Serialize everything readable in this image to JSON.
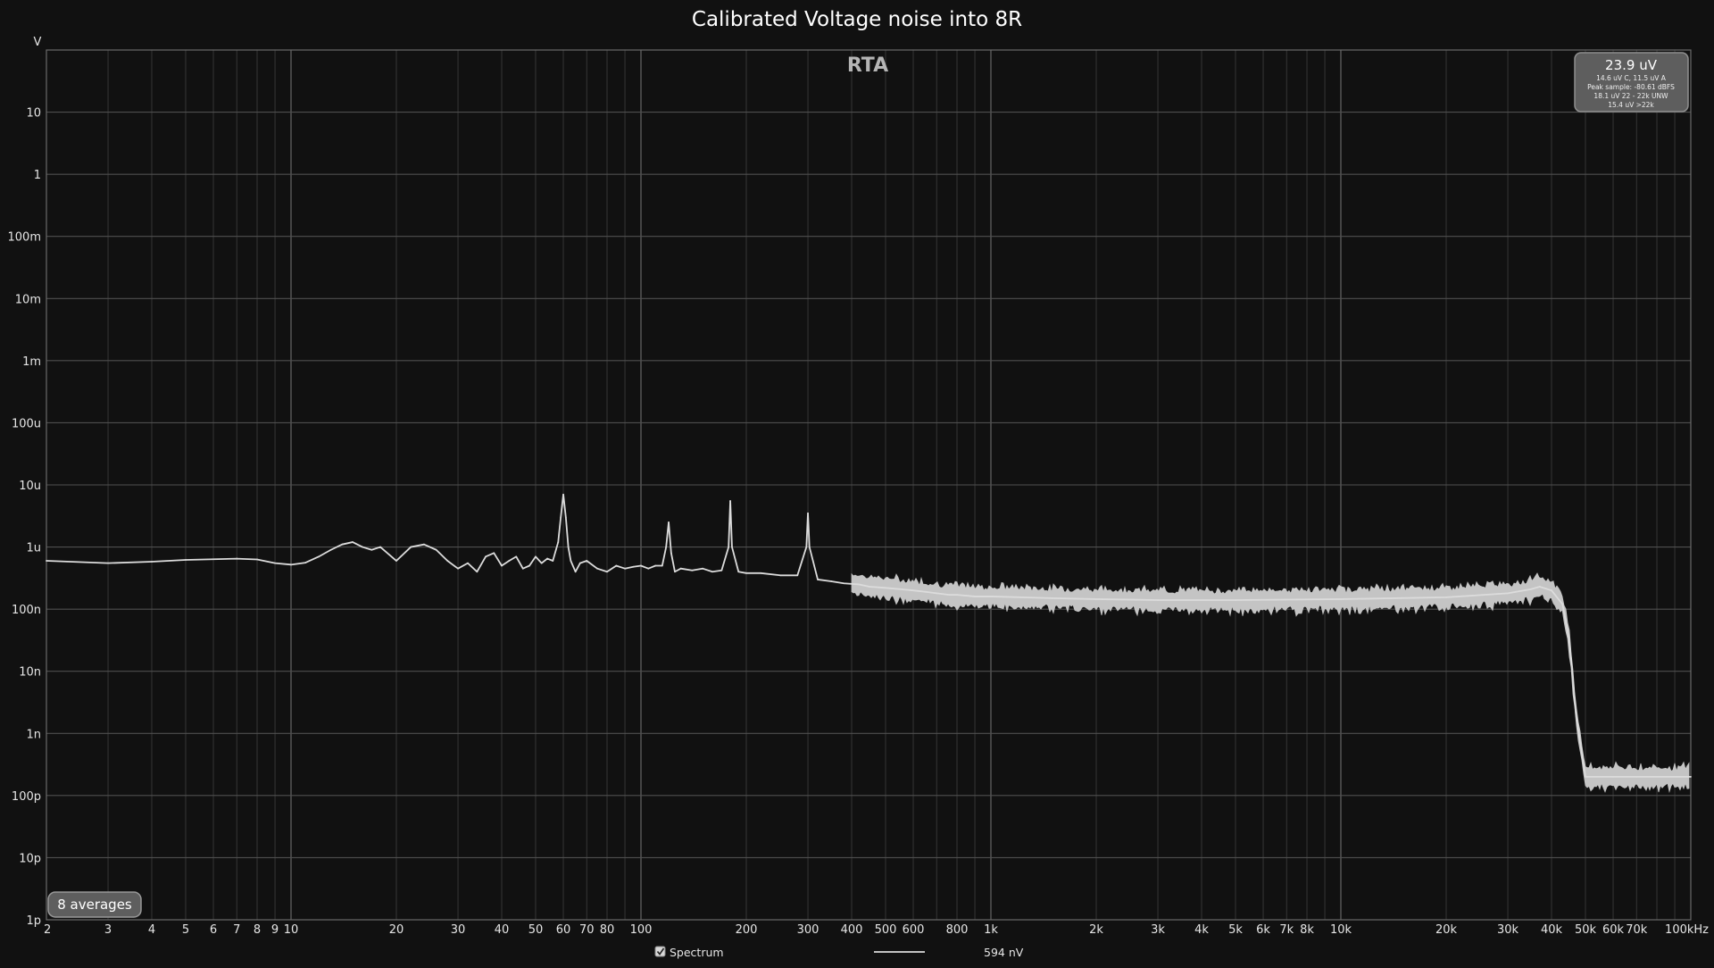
{
  "chart_data": {
    "type": "line",
    "title": "Calibrated Voltage noise into 8R",
    "watermark": "RTA",
    "y_unit_label": "V",
    "x_scale": "log",
    "y_scale": "log",
    "xlim": [
      2,
      100000
    ],
    "ylim": [
      1e-12,
      100
    ],
    "x_ticks": [
      {
        "v": 2,
        "label": "2"
      },
      {
        "v": 3,
        "label": "3"
      },
      {
        "v": 4,
        "label": "4"
      },
      {
        "v": 5,
        "label": "5"
      },
      {
        "v": 6,
        "label": "6"
      },
      {
        "v": 7,
        "label": "7"
      },
      {
        "v": 8,
        "label": "8"
      },
      {
        "v": 9,
        "label": "9"
      },
      {
        "v": 10,
        "label": "10"
      },
      {
        "v": 20,
        "label": "20"
      },
      {
        "v": 30,
        "label": "30"
      },
      {
        "v": 40,
        "label": "40"
      },
      {
        "v": 50,
        "label": "50"
      },
      {
        "v": 60,
        "label": "60"
      },
      {
        "v": 70,
        "label": "70"
      },
      {
        "v": 80,
        "label": "80"
      },
      {
        "v": 100,
        "label": "100"
      },
      {
        "v": 200,
        "label": "200"
      },
      {
        "v": 300,
        "label": "300"
      },
      {
        "v": 400,
        "label": "400"
      },
      {
        "v": 500,
        "label": "500"
      },
      {
        "v": 600,
        "label": "600"
      },
      {
        "v": 800,
        "label": "800"
      },
      {
        "v": 1000,
        "label": "1k"
      },
      {
        "v": 2000,
        "label": "2k"
      },
      {
        "v": 3000,
        "label": "3k"
      },
      {
        "v": 4000,
        "label": "4k"
      },
      {
        "v": 5000,
        "label": "5k"
      },
      {
        "v": 6000,
        "label": "6k"
      },
      {
        "v": 7000,
        "label": "7k"
      },
      {
        "v": 8000,
        "label": "8k"
      },
      {
        "v": 10000,
        "label": "10k"
      },
      {
        "v": 20000,
        "label": "20k"
      },
      {
        "v": 30000,
        "label": "30k"
      },
      {
        "v": 40000,
        "label": "40k"
      },
      {
        "v": 50000,
        "label": "50k"
      },
      {
        "v": 60000,
        "label": "60k"
      },
      {
        "v": 70000,
        "label": "70k"
      },
      {
        "v": 100000,
        "label": "100kHz"
      }
    ],
    "y_ticks": [
      {
        "v": 10,
        "label": "10"
      },
      {
        "v": 1,
        "label": "1"
      },
      {
        "v": 0.1,
        "label": "100m"
      },
      {
        "v": 0.01,
        "label": "10m"
      },
      {
        "v": 0.001,
        "label": "1m"
      },
      {
        "v": 0.0001,
        "label": "100u"
      },
      {
        "v": 1e-05,
        "label": "10u"
      },
      {
        "v": 1e-06,
        "label": "1u"
      },
      {
        "v": 1e-07,
        "label": "100n"
      },
      {
        "v": 1e-08,
        "label": "10n"
      },
      {
        "v": 1e-09,
        "label": "1n"
      },
      {
        "v": 1e-10,
        "label": "100p"
      },
      {
        "v": 1e-11,
        "label": "10p"
      },
      {
        "v": 1e-12,
        "label": "1p"
      }
    ],
    "grid": true,
    "legend_position": "bottom-center",
    "series": [
      {
        "name": "Spectrum",
        "legend_value": "594 nV",
        "color": "#dcdcdc",
        "x": [
          2,
          3,
          4,
          5,
          7,
          8,
          9,
          10,
          11,
          12,
          13,
          14,
          15,
          16,
          17,
          18,
          20,
          22,
          24,
          26,
          28,
          30,
          32,
          34,
          36,
          38,
          40,
          42,
          44,
          46,
          48,
          50,
          52,
          54,
          56,
          58,
          59,
          60,
          61,
          62,
          63,
          65,
          67,
          70,
          75,
          80,
          85,
          90,
          95,
          100,
          105,
          110,
          115,
          118,
          120,
          122,
          125,
          130,
          140,
          150,
          160,
          170,
          178,
          180,
          182,
          190,
          200,
          220,
          250,
          280,
          297,
          300,
          303,
          320,
          350,
          380,
          420,
          450,
          500,
          550,
          600,
          650,
          700,
          760,
          800,
          900,
          1000,
          1500,
          2000,
          3000,
          5000,
          10000,
          20000,
          30000,
          35000,
          37000,
          40000,
          43000,
          45000,
          47000,
          50000,
          60000,
          70000,
          100000
        ],
        "y": [
          6e-07,
          5.5e-07,
          5.8e-07,
          6.2e-07,
          6.5e-07,
          6.3e-07,
          5.5e-07,
          5.2e-07,
          5.6e-07,
          7e-07,
          9e-07,
          1.1e-06,
          1.2e-06,
          1e-06,
          9e-07,
          1e-06,
          6e-07,
          1e-06,
          1.1e-06,
          9e-07,
          6e-07,
          4.5e-07,
          5.5e-07,
          4e-07,
          7e-07,
          8e-07,
          5e-07,
          6e-07,
          7e-07,
          4.5e-07,
          5e-07,
          7e-07,
          5.5e-07,
          6.5e-07,
          6e-07,
          1.2e-06,
          3e-06,
          7e-06,
          3e-06,
          1e-06,
          6e-07,
          4e-07,
          5.5e-07,
          6e-07,
          4.5e-07,
          4e-07,
          5e-07,
          4.5e-07,
          4.8e-07,
          5e-07,
          4.5e-07,
          5e-07,
          5e-07,
          1e-06,
          2.5e-06,
          8e-07,
          4e-07,
          4.5e-07,
          4.2e-07,
          4.5e-07,
          4e-07,
          4.2e-07,
          1e-06,
          5.5e-06,
          1e-06,
          4e-07,
          3.8e-07,
          3.8e-07,
          3.5e-07,
          3.5e-07,
          1e-06,
          3.5e-06,
          1e-06,
          3e-07,
          2.8e-07,
          2.6e-07,
          2.5e-07,
          2.3e-07,
          2.2e-07,
          2.1e-07,
          2e-07,
          1.9e-07,
          1.8e-07,
          1.7e-07,
          1.7e-07,
          1.6e-07,
          1.6e-07,
          1.5e-07,
          1.45e-07,
          1.4e-07,
          1.4e-07,
          1.45e-07,
          1.55e-07,
          1.8e-07,
          2.1e-07,
          2.3e-07,
          2e-07,
          1.2e-07,
          3e-08,
          2e-09,
          2e-10,
          2e-10,
          2e-10,
          2e-10
        ]
      }
    ]
  },
  "overlays": {
    "averages_badge": "8 averages",
    "stats_box": {
      "main": "23.9 uV",
      "lines": [
        "14.6 uV C, 11.5 uV A",
        "Peak sample: -80.61 dBFS",
        "18.1 uV 22 - 22k UNW",
        "15.4 uV >22k"
      ]
    }
  },
  "legend": {
    "checkbox_checked": true,
    "label": "Spectrum",
    "value": "594 nV"
  }
}
